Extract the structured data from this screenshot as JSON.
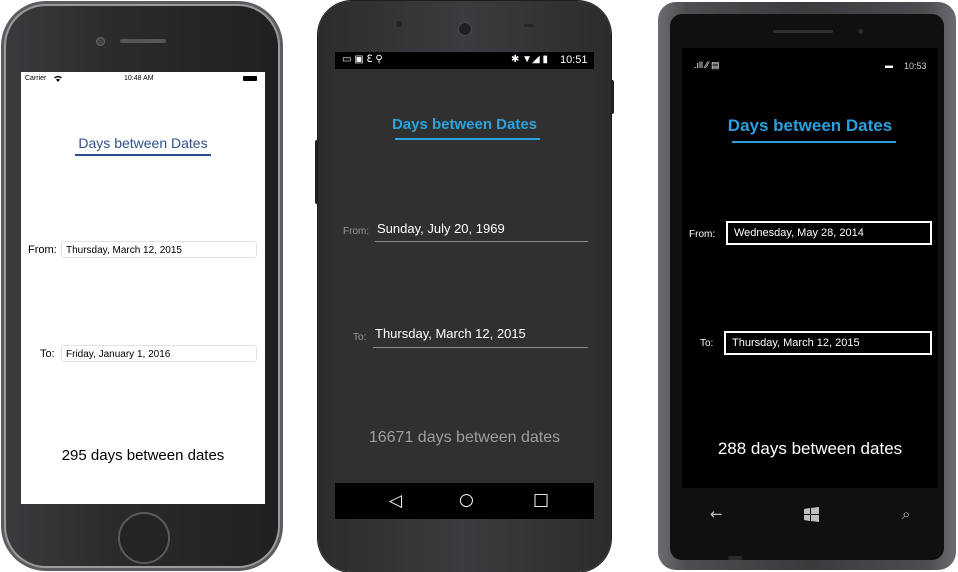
{
  "ios": {
    "status": {
      "carrier": "Carrier",
      "time": "10:48 AM"
    },
    "title": "Days between Dates",
    "from_label": "From:",
    "from_value": "Thursday, March 12, 2015",
    "to_label": "To:",
    "to_value": "Friday, January 1, 2016",
    "result": "295 days between dates"
  },
  "android": {
    "status": {
      "time": "10:51"
    },
    "title": "Days between Dates",
    "from_label": "From:",
    "from_value": "Sunday, July 20, 1969",
    "to_label": "To:",
    "to_value": "Thursday, March 12, 2015",
    "result": "16671 days between dates",
    "nav": {
      "back": "◁",
      "home": "○",
      "recents": "□"
    }
  },
  "windows": {
    "status": {
      "time": "10:53"
    },
    "title": "Days between Dates",
    "from_label": "From:",
    "from_value": "Wednesday, May 28, 2014",
    "to_label": "To:",
    "to_value": "Thursday, March 12, 2015",
    "result": "288 days between dates",
    "nav": {
      "back": "←",
      "search": "⌕"
    }
  },
  "colors": {
    "ios_accent": "#2f4f8a",
    "android_accent": "#2aa3de",
    "windows_accent": "#2a9fe0"
  }
}
